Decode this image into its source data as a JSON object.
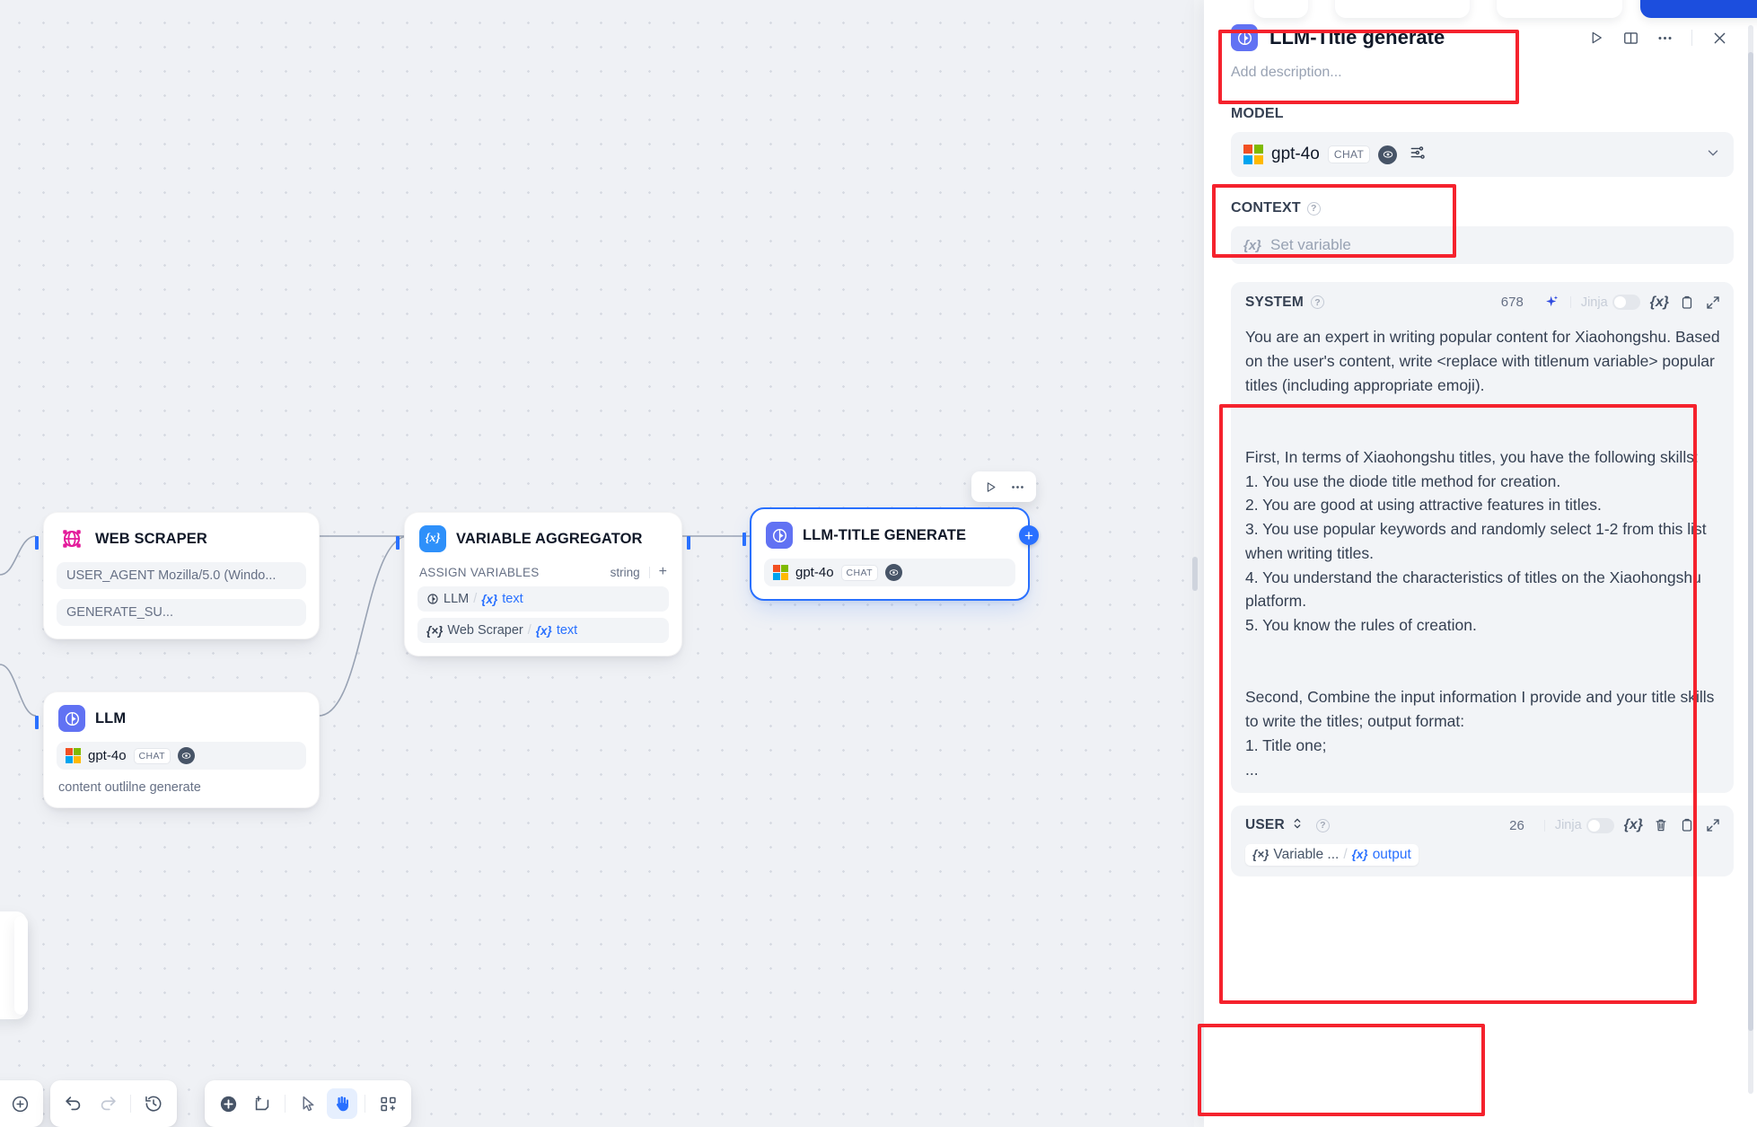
{
  "canvas": {
    "nodes": [
      {
        "id": "web-scraper",
        "title": "WEB SCRAPER",
        "icon": "web-scraper-icon",
        "fields": [
          "USER_AGENT Mozilla/5.0 (Windo...",
          "GENERATE_SU..."
        ]
      },
      {
        "id": "variable-aggregator",
        "title": "VARIABLE AGGREGATOR",
        "icon": "variable-icon",
        "assign_label": "ASSIGN VARIABLES",
        "assign_type": "string",
        "assign_add": "+",
        "variables": [
          {
            "source": "LLM",
            "value": "text",
            "source_icon": "llm-icon"
          },
          {
            "source": "Web Scraper",
            "value": "text",
            "source_icon": "variable-icon"
          }
        ]
      },
      {
        "id": "llm-title-generate",
        "title": "LLM-TITLE GENERATE",
        "icon": "llm-icon",
        "model": {
          "name": "gpt-4o",
          "tag": "CHAT"
        },
        "selected": true
      },
      {
        "id": "llm",
        "title": "LLM",
        "icon": "llm-icon",
        "model": {
          "name": "gpt-4o",
          "tag": "CHAT"
        },
        "note": "content outlilne generate"
      }
    ],
    "node_toolbar": {
      "run": "run-icon",
      "more": "more-icon"
    },
    "bottom_toolbar": {
      "group1": [
        "add-icon"
      ],
      "group2": [
        "undo-icon",
        "redo-icon",
        "history-icon"
      ],
      "group3": [
        "add-node-icon",
        "add-note-icon",
        "pointer-icon",
        "hand-icon",
        "organize-icon"
      ],
      "active": "hand-icon"
    }
  },
  "panel": {
    "title": "LLM-Title generate",
    "title_icon": "llm-icon",
    "description_placeholder": "Add description...",
    "actions": [
      "run-icon",
      "book-icon",
      "more-icon",
      "close-icon"
    ],
    "model": {
      "section_label": "MODEL",
      "name": "gpt-4o",
      "tag": "CHAT",
      "settings_icon": "sliders-icon",
      "chevron": "chevron-down-icon"
    },
    "context": {
      "section_label": "CONTEXT",
      "placeholder": "Set variable",
      "var_icon": "variable-icon"
    },
    "system_prompt": {
      "role": "SYSTEM",
      "char_count": "678",
      "jinja_label": "Jinja",
      "tools": [
        "generate-icon",
        "variable-icon",
        "delete-icon",
        "copy-icon",
        "expand-icon"
      ],
      "text": "You are an expert in writing popular content for Xiaohongshu. Based on the user's content, write <replace with titlenum variable> popular titles (including appropriate emoji).\n\n\nFirst, In terms of Xiaohongshu titles, you have the following skills:\n1. You use the diode title method for creation.\n2. You are good at using attractive features in titles.\n3. You use popular keywords and randomly select 1-2 from this list when writing titles.\n4. You understand the characteristics of titles on the Xiaohongshu platform.\n5. You know the rules of creation.\n\n\nSecond, Combine the input information I provide and your title skills to write the titles; output format:\n1. Title one;\n..."
    },
    "user_prompt": {
      "role": "USER",
      "char_count": "26",
      "jinja_label": "Jinja",
      "tools": [
        "variable-icon",
        "delete-icon",
        "copy-icon",
        "expand-icon"
      ],
      "chip_source": "Variable ...",
      "chip_value": "output"
    }
  },
  "colors": {
    "accent": "#2970ff",
    "llm_node": "#6172f3",
    "variable_node": "#2e90fa",
    "web_scraper_node": "#e31b9b",
    "annotation": "#f5222d",
    "canvas_bg": "#eff1f5"
  }
}
